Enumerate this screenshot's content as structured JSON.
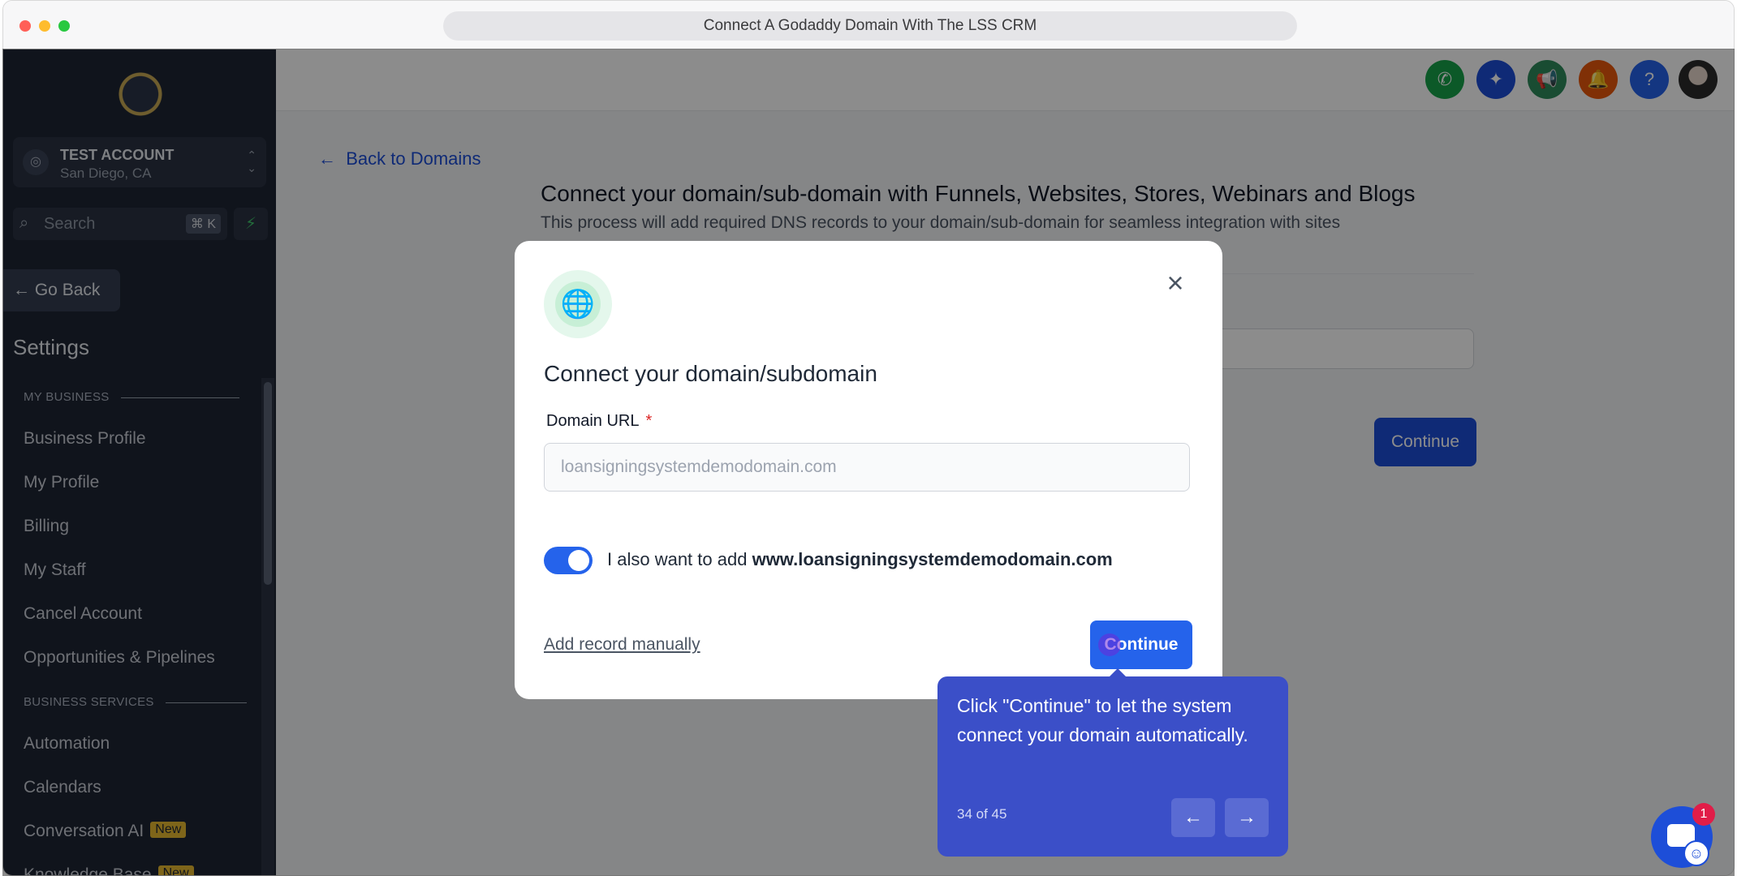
{
  "window": {
    "title": "Connect A Godaddy Domain With The LSS CRM"
  },
  "sidebar": {
    "account": {
      "name": "TEST ACCOUNT",
      "location": "San Diego, CA"
    },
    "search": {
      "placeholder": "Search",
      "shortcut": "⌘ K"
    },
    "go_back": "Go Back",
    "settings_title": "Settings",
    "sections": [
      {
        "label": "MY BUSINESS",
        "items": [
          "Business Profile",
          "My Profile",
          "Billing",
          "My Staff",
          "Cancel Account",
          "Opportunities & Pipelines"
        ]
      },
      {
        "label": "BUSINESS SERVICES",
        "items": [
          "Automation",
          "Calendars",
          "Conversation AI",
          "Knowledge Base"
        ]
      }
    ],
    "badges": {
      "conversation_ai": "New",
      "knowledge_base": "New"
    }
  },
  "header": {
    "icons": [
      {
        "name": "phone-icon",
        "color": "#16a34a"
      },
      {
        "name": "sparkle-icon",
        "color": "#1d4ed8"
      },
      {
        "name": "megaphone-icon",
        "color": "#2f8a5b"
      },
      {
        "name": "bell-icon",
        "color": "#ea580c"
      },
      {
        "name": "help-icon",
        "color": "#2563eb"
      }
    ]
  },
  "page": {
    "back_link": "Back to Domains",
    "title": "Connect your domain/sub-domain with Funnels, Websites, Stores, Webinars and Blogs",
    "subtitle": "This process will add required DNS records to your domain/sub-domain for seamless integration with sites",
    "continue_label": "Continue"
  },
  "modal": {
    "title": "Connect your domain/subdomain",
    "field_label": "Domain URL",
    "required_mark": "*",
    "field_value": "loansigningsystemdemodomain.com",
    "toggle_on": true,
    "toggle_text_prefix": "I also want to add",
    "toggle_text_domain": "www.loansigningsystemdemodomain.com",
    "add_manual": "Add record manually",
    "continue_label": "Continue"
  },
  "tooltip": {
    "text": "Click \"Continue\" to let the system connect your domain automatically.",
    "step": "34 of 45"
  },
  "chat": {
    "unread": "1"
  },
  "colors": {
    "accent": "#2563eb",
    "tooltip": "#3b4fc8",
    "sidebar": "#1e2533"
  }
}
